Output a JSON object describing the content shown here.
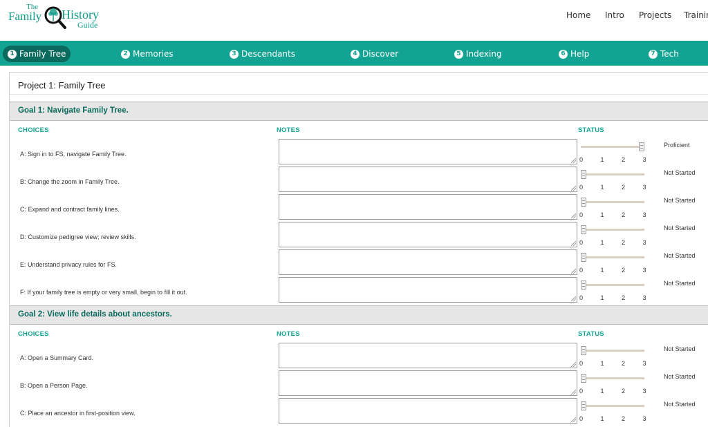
{
  "logo": {
    "the": "The",
    "family": "Family",
    "history": "History",
    "guide": "Guide"
  },
  "top_nav": [
    "Home",
    "Intro",
    "Projects",
    "Trainin"
  ],
  "tabs": [
    {
      "num": "1",
      "label": "Family Tree",
      "active": true
    },
    {
      "num": "2",
      "label": "Memories"
    },
    {
      "num": "3",
      "label": "Descendants"
    },
    {
      "num": "4",
      "label": "Discover"
    },
    {
      "num": "5",
      "label": "Indexing"
    },
    {
      "num": "6",
      "label": "Help"
    },
    {
      "num": "7",
      "label": "Tech"
    }
  ],
  "project_title": "Project 1: Family Tree",
  "columns": {
    "choices": "CHOICES",
    "notes": "NOTES",
    "status": "STATUS"
  },
  "ticks": [
    "0",
    "1",
    "2",
    "3"
  ],
  "goals": [
    {
      "title": "Goal 1: Navigate Family Tree.",
      "items": [
        {
          "choice": "A: Sign in to FS, navigate Family Tree.",
          "level": 3,
          "status": "Proficient"
        },
        {
          "choice": "B: Change the zoom in Family Tree.",
          "level": 0,
          "status": "Not Started"
        },
        {
          "choice": "C: Expand and contract family lines.",
          "level": 0,
          "status": "Not Started"
        },
        {
          "choice": "D: Customize pedigree view; review skills.",
          "level": 0,
          "status": "Not Started"
        },
        {
          "choice": "E: Understand privacy rules for FS.",
          "level": 0,
          "status": "Not Started"
        },
        {
          "choice": "F: If your family tree is empty or very small, begin to fill it out.",
          "level": 0,
          "status": "Not Started"
        }
      ]
    },
    {
      "title": "Goal 2: View life details about ancestors.",
      "items": [
        {
          "choice": "A: Open a Summary Card.",
          "level": 0,
          "status": "Not Started"
        },
        {
          "choice": "B: Open a Person Page.",
          "level": 0,
          "status": "Not Started"
        },
        {
          "choice": "C: Place an ancestor in first-position view.",
          "level": 0,
          "status": "Not Started"
        }
      ]
    }
  ],
  "colors": {
    "teal": "#12a392",
    "dark_teal": "#0b6a5e"
  }
}
